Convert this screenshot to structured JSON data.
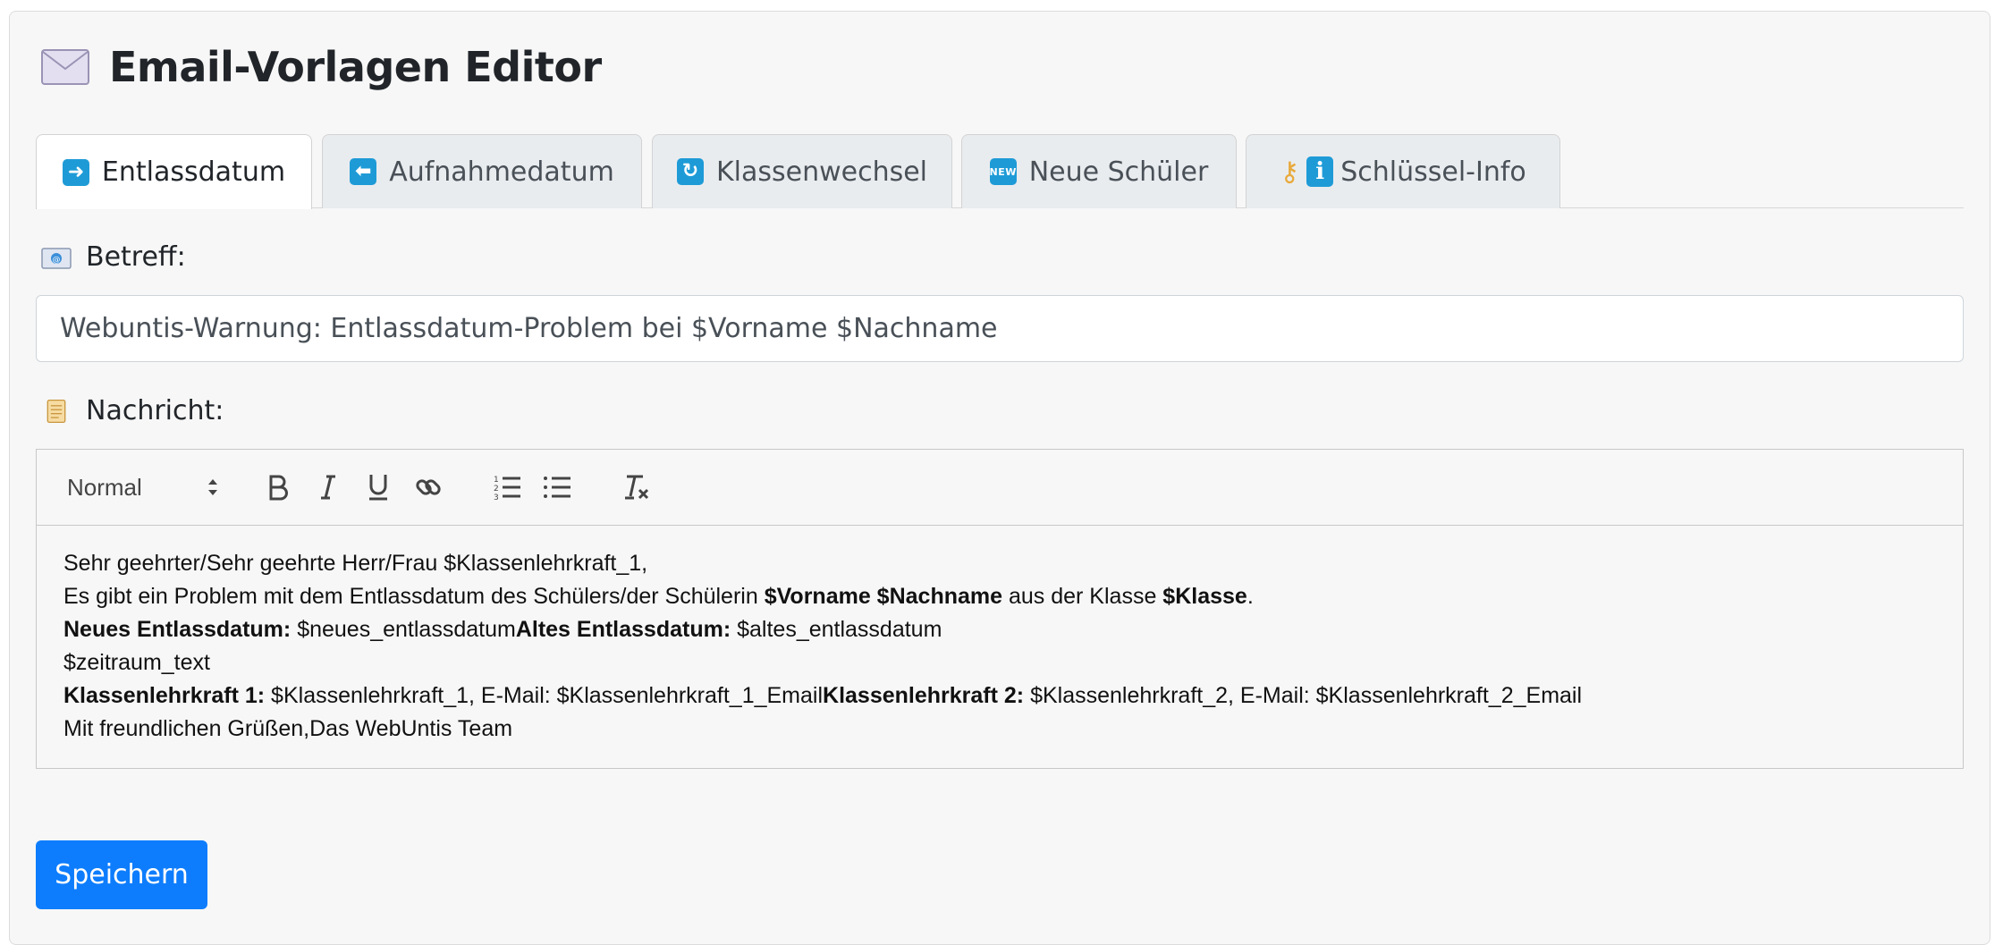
{
  "header": {
    "title": "Email-Vorlagen Editor",
    "icon": "envelope-icon"
  },
  "tabs": [
    {
      "label": "Entlassdatum",
      "icon": "arrow-right-icon",
      "active": true
    },
    {
      "label": "Aufnahmedatum",
      "icon": "arrow-left-icon",
      "active": false
    },
    {
      "label": "Klassenwechsel",
      "icon": "refresh-icon",
      "active": false
    },
    {
      "label": "Neue Schüler",
      "icon": "new-badge-icon",
      "active": false
    },
    {
      "label": "Schlüssel-Info",
      "icon": "key-info-icon",
      "active": false
    }
  ],
  "subject": {
    "label": "Betreff:",
    "value": "Webuntis-Warnung: Entlassdatum-Problem bei $Vorname $Nachname"
  },
  "message": {
    "label": "Nachricht:",
    "format_select": "Normal",
    "lines": {
      "l1": "Sehr geehrter/Sehr geehrte Herr/Frau $Klassenlehrkraft_1,",
      "l2_a": "Es gibt ein Problem mit dem Entlassdatum des Schülers/der Schülerin ",
      "l2_b": "$Vorname $Nachname",
      "l2_c": " aus der Klasse ",
      "l2_d": "$Klasse",
      "l2_e": ".",
      "l3_a": "Neues Entlassdatum:",
      "l3_b": " $neues_entlassdatum",
      "l3_c": "Altes Entlassdatum:",
      "l3_d": " $altes_entlassdatum",
      "l4": "$zeitraum_text",
      "l5_a": "Klassenlehrkraft 1:",
      "l5_b": " $Klassenlehrkraft_1, E-Mail: $Klassenlehrkraft_1_Email",
      "l5_c": "Klassenlehrkraft 2:",
      "l5_d": " $Klassenlehrkraft_2, E-Mail: $Klassenlehrkraft_2_Email",
      "l6": "Mit freundlichen Grüßen,Das WebUntis Team"
    }
  },
  "actions": {
    "save_label": "Speichern"
  },
  "colors": {
    "primary": "#0d7dfd",
    "tab_icon": "#1e9bd7"
  }
}
